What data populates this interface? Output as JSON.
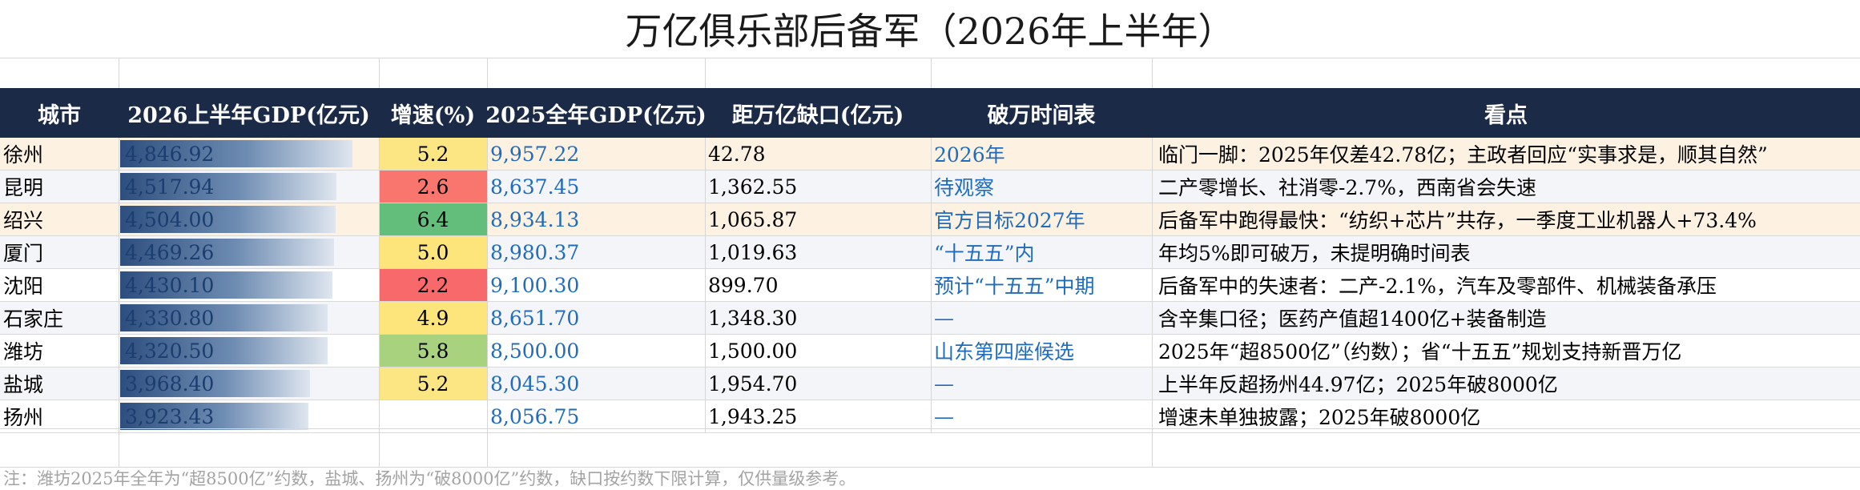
{
  "title": "万亿俱乐部后备军（2026年上半年）",
  "columns": {
    "city": "城市",
    "gdp_h1": "2026上半年GDP(亿元)",
    "growth": "增速(%)",
    "gdp_2025": "2025全年GDP(亿元)",
    "gap": "距万亿缺口(亿元)",
    "timeline": "破万时间表",
    "highlights": "看点"
  },
  "gdp_max": 4846.92,
  "colors": {
    "header_bg": "#1b2a47",
    "growth_high": "#63be7b",
    "growth_mid": "#a9d27f",
    "growth_neutral": "#fbe683",
    "growth_mid_yellow": "#fde47b",
    "growth_low": "#f8696b",
    "highlight_row": "#fdf1e2"
  },
  "rows": [
    {
      "city": "徐州",
      "gdp_h1": "4,846.92",
      "gdp_value": 4846.92,
      "growth": "5.2",
      "growth_color": "#fbe683",
      "gdp_2025": "9,957.22",
      "gap": "42.78",
      "timeline": "2026年",
      "highlights": "临门一脚：2025年仅差42.78亿；主政者回应“实事求是，顺其自然”",
      "style": "alt"
    },
    {
      "city": "昆明",
      "gdp_h1": "4,517.94",
      "gdp_value": 4517.94,
      "growth": "2.6",
      "growth_color": "#f8766d",
      "gdp_2025": "8,637.45",
      "gap": "1,362.55",
      "timeline": "待观察",
      "highlights": "二产零增长、社消零-2.7%，西南省会失速",
      "style": "plain"
    },
    {
      "city": "绍兴",
      "gdp_h1": "4,504.00",
      "gdp_value": 4504.0,
      "growth": "6.4",
      "growth_color": "#63be7b",
      "gdp_2025": "8,934.13",
      "gap": "1,065.87",
      "timeline": "官方目标2027年",
      "highlights": "后备军中跑得最快：“纺织+芯片”共存，一季度工业机器人+73.4%",
      "style": "alt"
    },
    {
      "city": "厦门",
      "gdp_h1": "4,469.26",
      "gdp_value": 4469.26,
      "growth": "5.0",
      "growth_color": "#fde47b",
      "gdp_2025": "8,980.37",
      "gap": "1,019.63",
      "timeline": "“十五五”内",
      "highlights": "年均5%即可破万，未提明确时间表",
      "style": "plain"
    },
    {
      "city": "沈阳",
      "gdp_h1": "4,430.10",
      "gdp_value": 4430.1,
      "growth": "2.2",
      "growth_color": "#f8696b",
      "gdp_2025": "9,100.30",
      "gap": "899.70",
      "timeline": "预计“十五五”中期",
      "highlights": "后备军中的失速者：二产-2.1%，汽车及零部件、机械装备承压",
      "style": "white"
    },
    {
      "city": "石家庄",
      "gdp_h1": "4,330.80",
      "gdp_value": 4330.8,
      "growth": "4.9",
      "growth_color": "#fde47b",
      "gdp_2025": "8,651.70",
      "gap": "1,348.30",
      "timeline": "—",
      "highlights": "含辛集口径；医药产值超1400亿+装备制造",
      "style": "plain"
    },
    {
      "city": "潍坊",
      "gdp_h1": "4,320.50",
      "gdp_value": 4320.5,
      "growth": "5.8",
      "growth_color": "#a9d27f",
      "gdp_2025": "8,500.00",
      "gap": "1,500.00",
      "timeline": "山东第四座候选",
      "highlights": "2025年“超8500亿”（约数）；省“十五五”规划支持新晋万亿",
      "style": "white"
    },
    {
      "city": "盐城",
      "gdp_h1": "3,968.40",
      "gdp_value": 3968.4,
      "growth": "5.2",
      "growth_color": "#fbe683",
      "gdp_2025": "8,045.30",
      "gap": "1,954.70",
      "timeline": "—",
      "highlights": "上半年反超扬州44.97亿；2025年破8000亿",
      "style": "plain"
    },
    {
      "city": "扬州",
      "gdp_h1": "3,923.43",
      "gdp_value": 3923.43,
      "growth": "",
      "growth_color": "",
      "gdp_2025": "8,056.75",
      "gap": "1,943.25",
      "timeline": "—",
      "highlights": "增速未单独披露；2025年破8000亿",
      "style": "white"
    }
  ],
  "note": "注：潍坊2025年全年为“超8500亿”约数，盐城、扬州为“破8000亿”约数，缺口按约数下限计算，仅供量级参考。"
}
